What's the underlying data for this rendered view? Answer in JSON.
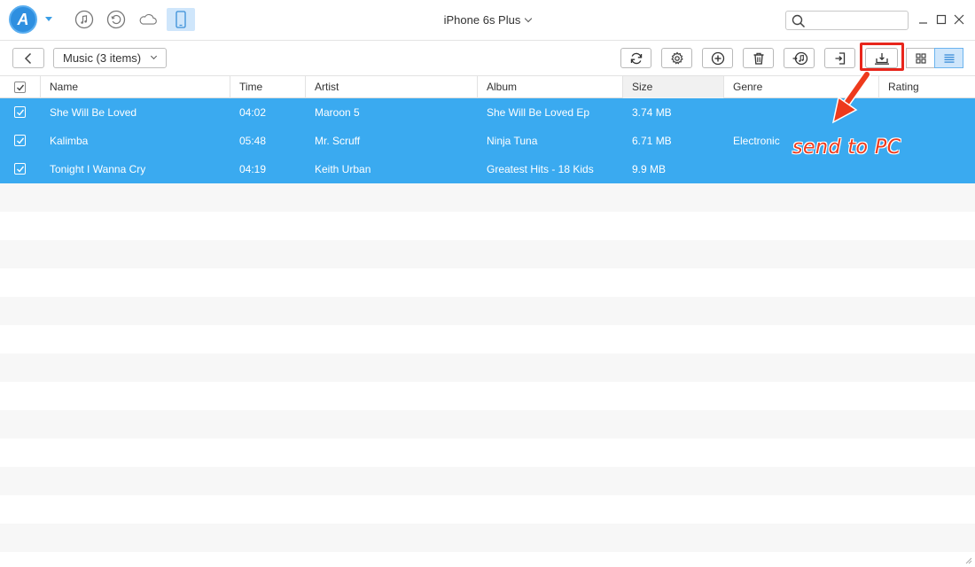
{
  "app": {
    "logo_letter": "A",
    "device_name": "iPhone 6s Plus",
    "search_placeholder": ""
  },
  "colors": {
    "accent": "#3aaaf0",
    "selected_row": "#3aaaf0",
    "highlight": "#e8261c",
    "annotation": "#ee3a1c"
  },
  "nav": [
    "music-icon",
    "history-icon",
    "cloud-icon",
    "phone-icon"
  ],
  "toolbar": {
    "category_label": "Music (3 items)",
    "tools": [
      "refresh-icon",
      "settings-icon",
      "add-icon",
      "delete-icon",
      "to-itunes-icon",
      "to-device-icon",
      "send-to-pc-icon"
    ],
    "views": [
      "grid-view-icon",
      "list-view-icon"
    ]
  },
  "table": {
    "columns": [
      "Name",
      "Time",
      "Artist",
      "Album",
      "Size",
      "Genre",
      "Rating"
    ],
    "rows": [
      {
        "name": "She Will Be Loved",
        "time": "04:02",
        "artist": "Maroon 5",
        "album": "She Will Be Loved Ep",
        "size": "3.74 MB",
        "genre": "",
        "rating": ""
      },
      {
        "name": "Kalimba",
        "time": "05:48",
        "artist": "Mr. Scruff",
        "album": "Ninja Tuna",
        "size": "6.71 MB",
        "genre": "Electronic",
        "rating": ""
      },
      {
        "name": "Tonight I Wanna Cry",
        "time": "04:19",
        "artist": "Keith Urban",
        "album": "Greatest Hits - 18 Kids",
        "size": "9.9 MB",
        "genre": "",
        "rating": ""
      }
    ]
  },
  "annotation": {
    "text": "send to PC"
  }
}
